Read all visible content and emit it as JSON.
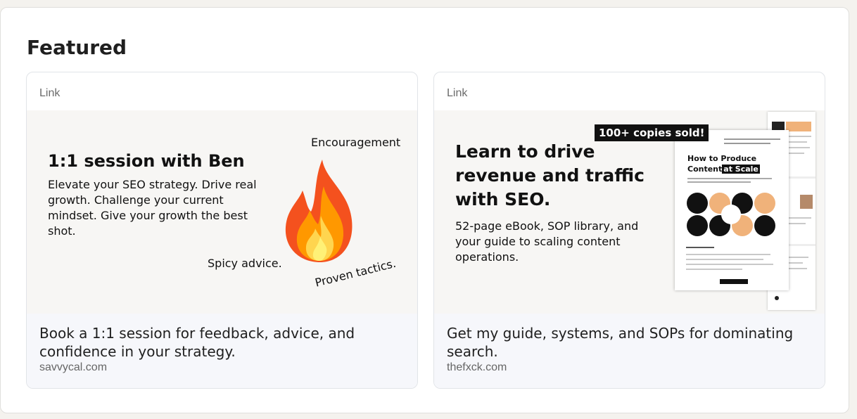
{
  "section": {
    "title": "Featured"
  },
  "cards": [
    {
      "kind": "Link",
      "headline": "Book a 1:1 session for feedback, advice, and confidence in your strategy.",
      "domain": "savvycal.com",
      "image": {
        "title": "1:1 session with Ben",
        "description": "Elevate your SEO strategy. Drive real growth. Challenge your current mindset. Give your growth the best shot.",
        "tag_encouragement": "Encouragement",
        "tag_spicy": "Spicy advice.",
        "tag_proven": "Proven tactics.",
        "icon": "fire-icon"
      }
    },
    {
      "kind": "Link",
      "headline": "Get my guide, systems, and SOPs for dominating search.",
      "domain": "thefxck.com",
      "image": {
        "title": "Learn to drive revenue and traffic with SEO.",
        "description": "52-page eBook, SOP library, and your guide to scaling content operations.",
        "badge": "100+ copies sold!",
        "doc_title_line1": "How to Produce",
        "doc_title_line2a": "Content",
        "doc_title_line2b": "at Scale",
        "accent_color": "#f0b27a"
      }
    }
  ]
}
